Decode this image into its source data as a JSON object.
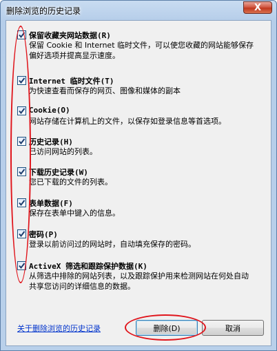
{
  "window": {
    "title": "删除浏览的历史记录",
    "close_label": "X"
  },
  "options": [
    {
      "title": "保留收藏夹网站数据(R)",
      "desc": "保留 Cookie 和 Internet 临时文件，可以使您收藏的网站能够保存偏好选项并提高显示速度。",
      "checked": true
    },
    {
      "title": "Internet 临时文件(T)",
      "desc": "为快速查看而保存的网页、图像和媒体的副本",
      "checked": true
    },
    {
      "title": "Cookie(O)",
      "desc": "网站存储在计算机上的文件，以保存如登录信息等首选项。",
      "checked": true
    },
    {
      "title": "历史记录(H)",
      "desc": "已访问网站的列表。",
      "checked": true
    },
    {
      "title": "下载历史记录(W)",
      "desc": "您已下载的文件的列表。",
      "checked": true
    },
    {
      "title": "表单数据(F)",
      "desc": "保存在表单中键入的信息。",
      "checked": true
    },
    {
      "title": "密码(P)",
      "desc": "登录以前访问过的网站时，自动填充保存的密码。",
      "checked": true
    },
    {
      "title": "ActiveX 筛选和跟踪保护数据(K)",
      "desc": "从筛选中排除的网站列表，以及跟踪保护用来检测网站在何处自动共享您访问的详细信息的数据。",
      "checked": true
    }
  ],
  "footer": {
    "link": "关于删除浏览的历史记录",
    "delete_button": "删除(D)",
    "cancel_button": "取消"
  },
  "colors": {
    "annotation": "#e0141b",
    "link": "#0033cc",
    "checkmark": "#1d3e6e"
  }
}
